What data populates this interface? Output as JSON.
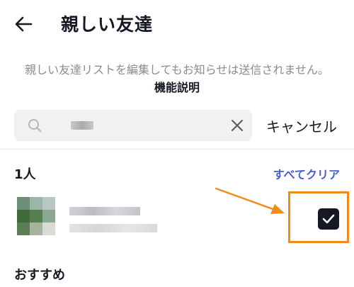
{
  "header": {
    "title": "親しい友達"
  },
  "notice": {
    "text": "親しい友達リストを編集してもお知らせは送信されません。",
    "link_label": "機能説明"
  },
  "search": {
    "cancel_label": "キャンセル"
  },
  "selected": {
    "count_label": "1人",
    "clear_all_label": "すべてクリア",
    "friends": [
      {
        "checked": true
      }
    ]
  },
  "recommend": {
    "label": "おすすめ"
  },
  "colors": {
    "accent": "#4a5bd5",
    "annotation": "#f08a18",
    "checkbox": "#161823"
  }
}
